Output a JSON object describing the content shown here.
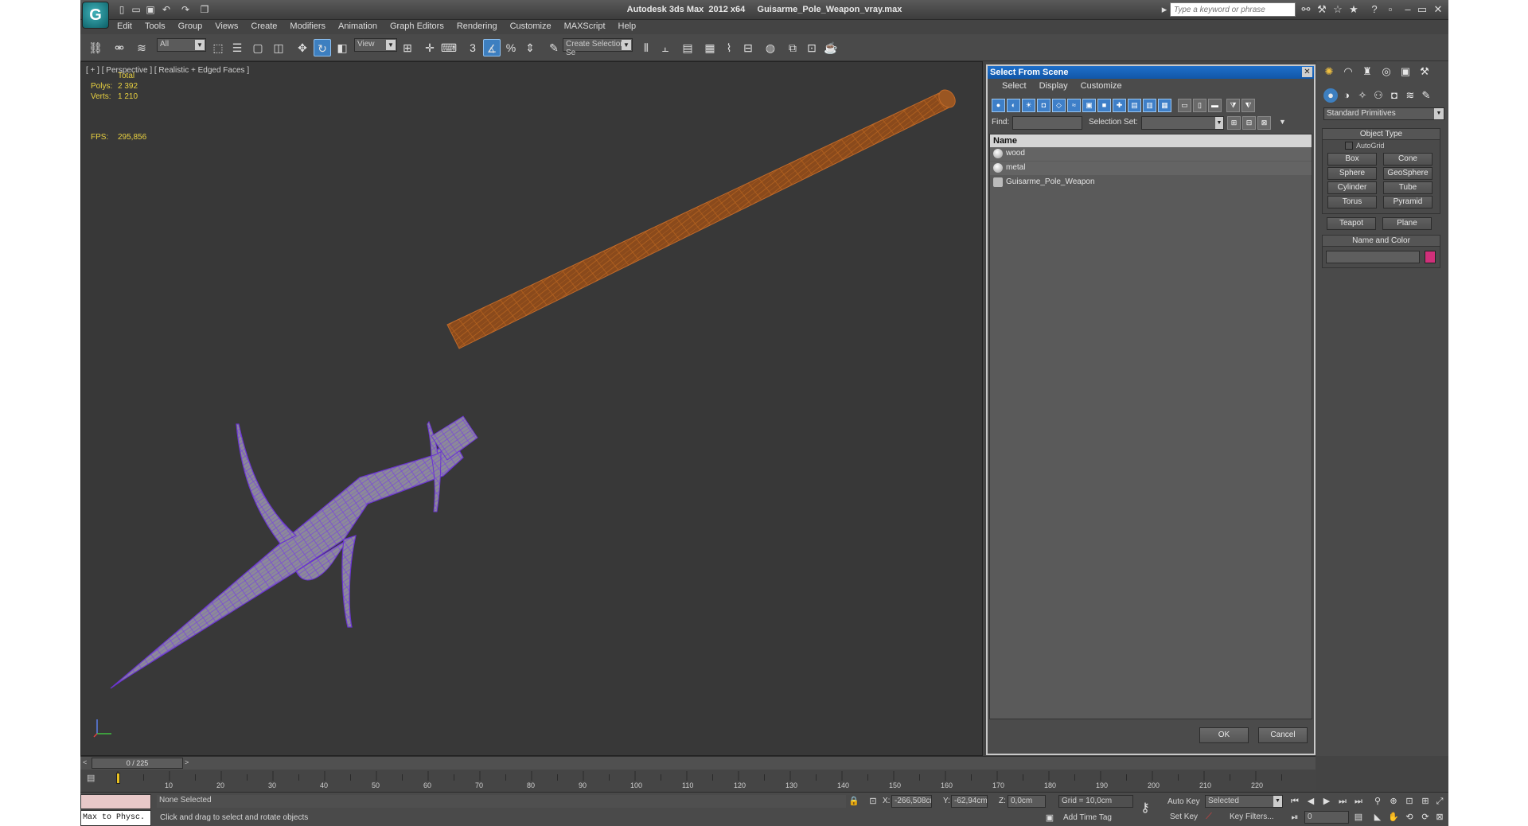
{
  "window": {
    "title": "Autodesk 3ds Max  2012 x64     Guisarme_Pole_Weapon_vray.max",
    "logo": "3ds-max-logo",
    "search_placeholder": "Type a keyword or phrase"
  },
  "menu": [
    "Edit",
    "Tools",
    "Group",
    "Views",
    "Create",
    "Modifiers",
    "Animation",
    "Graph Editors",
    "Rendering",
    "Customize",
    "MAXScript",
    "Help"
  ],
  "toolbar": {
    "selection_filter": "All",
    "reference_coord": "View",
    "named_selection_placeholder": "Create Selection Se",
    "snap_label": "3"
  },
  "viewport": {
    "label": "[ + ] [ Perspective ] [ Realistic + Edged Faces ]",
    "stats": {
      "total_label": "Total",
      "polys_label": "Polys:",
      "polys_value": "2 392",
      "verts_label": "Verts:",
      "verts_value": "1 210",
      "fps_label": "FPS:",
      "fps_value": "295,856"
    },
    "colors": {
      "wood": "#8a4a1c",
      "wood_wire": "#c06a2a",
      "metal_wire": "#7a3ed8",
      "metal_fill": "#8a8a9a"
    }
  },
  "dialog": {
    "title": "Select From Scene",
    "menu": [
      "Select",
      "Display",
      "Customize"
    ],
    "find_label": "Find:",
    "selection_set_label": "Selection Set:",
    "column_header": "Name",
    "items": [
      "wood",
      "metal",
      "Guisarme_Pole_Weapon"
    ],
    "ok_label": "OK",
    "cancel_label": "Cancel"
  },
  "command_panel": {
    "category": "Standard Primitives",
    "object_type_header": "Object Type",
    "autogrid_label": "AutoGrid",
    "buttons": [
      "Box",
      "Cone",
      "Sphere",
      "GeoSphere",
      "Cylinder",
      "Tube",
      "Torus",
      "Pyramid",
      "Teapot",
      "Plane"
    ],
    "name_color_header": "Name and Color",
    "object_color": "#d0307a"
  },
  "timeline": {
    "frame_display": "0 / 225",
    "ticks": [
      "10",
      "20",
      "30",
      "40",
      "50",
      "60",
      "70",
      "80",
      "90",
      "100",
      "110",
      "120",
      "130",
      "140",
      "150",
      "160",
      "170",
      "180",
      "190",
      "200",
      "210",
      "220"
    ]
  },
  "status": {
    "maxscript_listener": "Max to Physc.",
    "selection_status": "None Selected",
    "prompt": "Click and drag to select and rotate objects",
    "x_label": "X:",
    "x_value": "-266,508cr",
    "y_label": "Y:",
    "y_value": "-62,94cm",
    "z_label": "Z:",
    "z_value": "0,0cm",
    "grid": "Grid = 10,0cm",
    "add_time_tag": "Add Time Tag",
    "auto_key": "Auto Key",
    "key_mode": "Selected",
    "set_key": "Set Key",
    "key_filters": "Key Filters...",
    "current_frame": "0"
  }
}
